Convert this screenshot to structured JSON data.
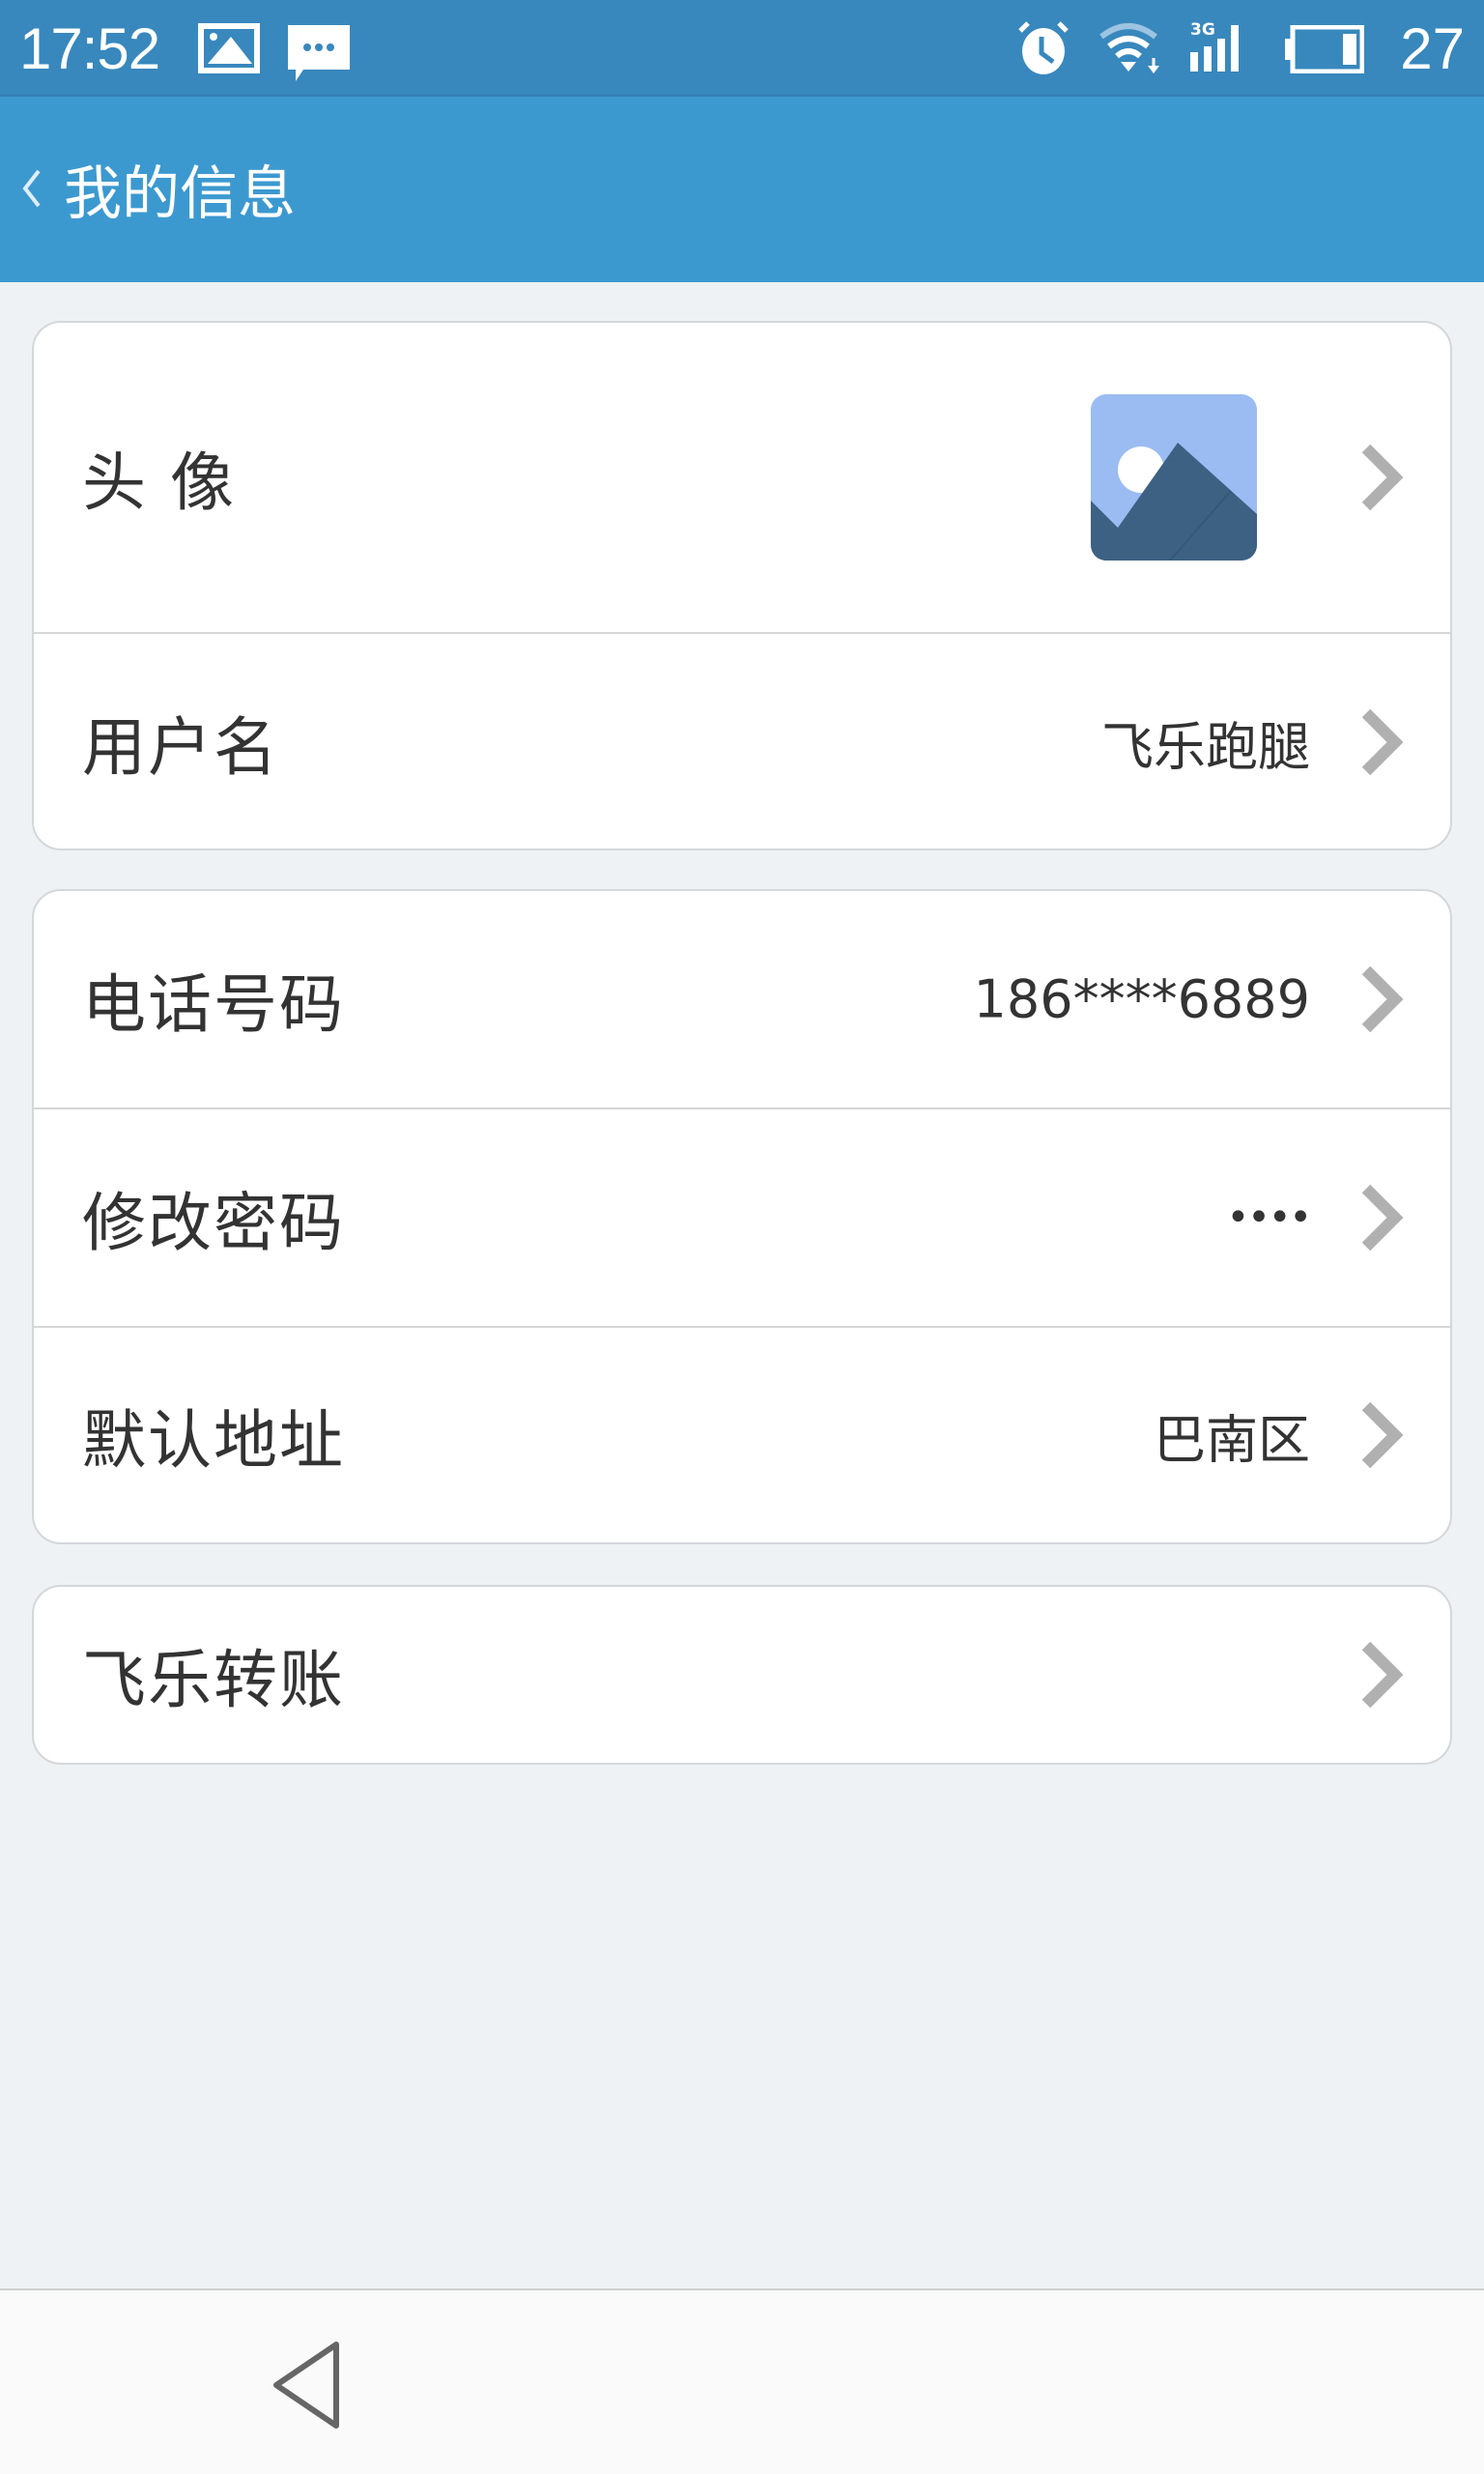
{
  "status_bar": {
    "time": "17:52",
    "left_icons": [
      "gallery-notification-icon",
      "message-notification-icon"
    ],
    "right_icons": [
      "alarm-icon",
      "wifi-icon",
      "3g-signal-icon",
      "battery-icon"
    ],
    "network_label": "3G",
    "battery_level": "27"
  },
  "header": {
    "back_icon": "chevron-left-icon",
    "title": "我的信息"
  },
  "colors": {
    "status_bar": "#3888bd",
    "header": "#3c99d0",
    "background": "#eef2f5",
    "chevron": "#b0b0b0",
    "avatar_sky": "#9bbcf3",
    "avatar_mountain": "#3d6183"
  },
  "groups": [
    {
      "items": [
        {
          "label": "头 像",
          "type": "avatar",
          "value": ""
        },
        {
          "label": "用户名",
          "type": "text",
          "value": "飞乐跑腿"
        }
      ]
    },
    {
      "items": [
        {
          "label": "电话号码",
          "type": "text",
          "value": "186****6889"
        },
        {
          "label": "修改密码",
          "type": "text",
          "value": "••••"
        },
        {
          "label": "默认地址",
          "type": "text",
          "value": "巴南区"
        }
      ]
    },
    {
      "items": [
        {
          "label": "飞乐转账",
          "type": "text",
          "value": ""
        }
      ]
    }
  ],
  "nav_bar": {
    "back_icon": "triangle-back-icon"
  }
}
